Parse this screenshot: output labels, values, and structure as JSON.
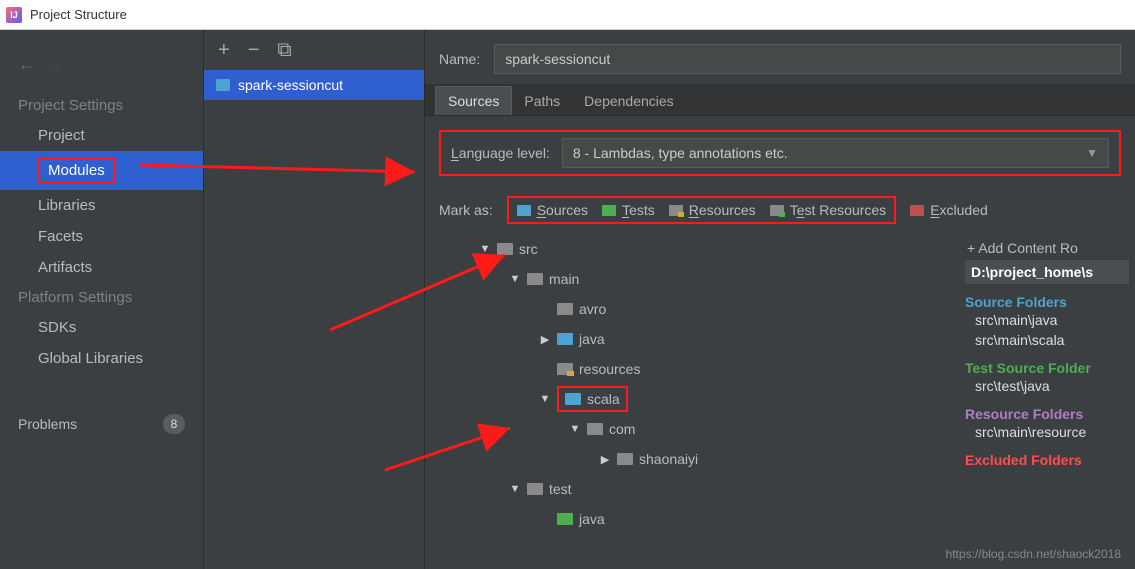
{
  "titlebar": {
    "title": "Project Structure"
  },
  "sidebar": {
    "section1": "Project Settings",
    "items1": {
      "project": "Project",
      "modules": "Modules",
      "libraries": "Libraries",
      "facets": "Facets",
      "artifacts": "Artifacts"
    },
    "section2": "Platform Settings",
    "items2": {
      "sdks": "SDKs",
      "globalLibs": "Global Libraries"
    },
    "problems": {
      "label": "Problems",
      "count": "8"
    }
  },
  "moduleList": {
    "selected": "spark-sessioncut"
  },
  "right": {
    "nameLabel": "Name:",
    "nameValue": "spark-sessioncut",
    "tabs": {
      "sources": "Sources",
      "paths": "Paths",
      "deps": "Dependencies"
    },
    "langLabel": "Language level:",
    "langValue": "8 - Lambdas, type annotations etc.",
    "markLabel": "Mark as:",
    "marks": {
      "sources": "Sources",
      "tests": "Tests",
      "resources": "Resources",
      "testres": "Test Resources",
      "excluded": "Excluded"
    },
    "tree": {
      "src": "src",
      "main": "main",
      "avro": "avro",
      "java": "java",
      "resources": "resources",
      "scala": "scala",
      "com": "com",
      "shaonaiyi": "shaonaiyi",
      "test": "test",
      "testjava": "java"
    },
    "info": {
      "add": "+ Add Content Ro",
      "path": "D:\\project_home\\s",
      "srcTitle": "Source Folders",
      "src1": "src\\main\\java",
      "src2": "src\\main\\scala",
      "tstTitle": "Test Source Folder",
      "tst1": "src\\test\\java",
      "resTitle": "Resource Folders",
      "res1": "src\\main\\resource",
      "excTitle": "Excluded Folders"
    }
  },
  "watermark": "https://blog.csdn.net/shaock2018"
}
